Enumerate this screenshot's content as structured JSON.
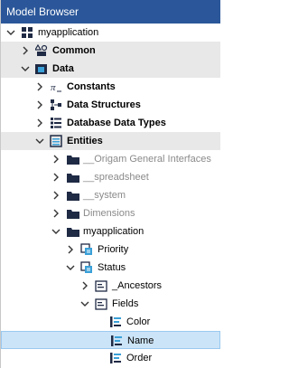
{
  "panel": {
    "title": "Model Browser"
  },
  "tree": [
    {
      "label": "myapplication",
      "icon": "package-icon",
      "arrow": "expanded",
      "level": 0,
      "style": "normal",
      "band": false
    },
    {
      "label": "Common",
      "icon": "shapes-icon",
      "arrow": "collapsed",
      "level": 1,
      "style": "bold",
      "band": true
    },
    {
      "label": "Data",
      "icon": "data-folder-icon",
      "arrow": "expanded",
      "level": 1,
      "style": "bold",
      "band": true
    },
    {
      "label": "Constants",
      "icon": "constants-icon",
      "arrow": "collapsed",
      "level": 2,
      "style": "bold",
      "band": false
    },
    {
      "label": "Data Structures",
      "icon": "data-structures-icon",
      "arrow": "collapsed",
      "level": 2,
      "style": "bold",
      "band": false
    },
    {
      "label": "Database Data Types",
      "icon": "database-types-icon",
      "arrow": "collapsed",
      "level": 2,
      "style": "bold",
      "band": false
    },
    {
      "label": "Entities",
      "icon": "entities-icon",
      "arrow": "expanded",
      "level": 2,
      "style": "bold",
      "band": true
    },
    {
      "label": "__Origam General Interfaces",
      "icon": "folder-icon",
      "arrow": "collapsed",
      "level": 3,
      "style": "grey",
      "band": false
    },
    {
      "label": "__spreadsheet",
      "icon": "folder-icon",
      "arrow": "collapsed",
      "level": 3,
      "style": "grey",
      "band": false
    },
    {
      "label": "__system",
      "icon": "folder-icon",
      "arrow": "collapsed",
      "level": 3,
      "style": "grey",
      "band": false
    },
    {
      "label": "Dimensions",
      "icon": "folder-icon",
      "arrow": "collapsed",
      "level": 3,
      "style": "grey",
      "band": false
    },
    {
      "label": "myapplication",
      "icon": "folder-icon",
      "arrow": "expanded",
      "level": 3,
      "style": "normal",
      "band": false
    },
    {
      "label": "Priority",
      "icon": "entity-icon",
      "arrow": "collapsed",
      "level": 4,
      "style": "normal",
      "band": false
    },
    {
      "label": "Status",
      "icon": "entity-icon",
      "arrow": "expanded",
      "level": 4,
      "style": "normal",
      "band": false
    },
    {
      "label": "_Ancestors",
      "icon": "ancestors-folder-icon",
      "arrow": "collapsed",
      "level": 5,
      "style": "normal",
      "band": false
    },
    {
      "label": "Fields",
      "icon": "fields-folder-icon",
      "arrow": "expanded",
      "level": 5,
      "style": "normal",
      "band": false
    },
    {
      "label": "Color",
      "icon": "field-icon",
      "arrow": "none",
      "level": 6,
      "style": "normal",
      "band": false
    },
    {
      "label": "Name",
      "icon": "field-icon",
      "arrow": "none",
      "level": 6,
      "style": "normal",
      "band": false,
      "selected": true
    },
    {
      "label": "Order",
      "icon": "field-icon",
      "arrow": "none",
      "level": 6,
      "style": "normal",
      "band": false
    }
  ]
}
